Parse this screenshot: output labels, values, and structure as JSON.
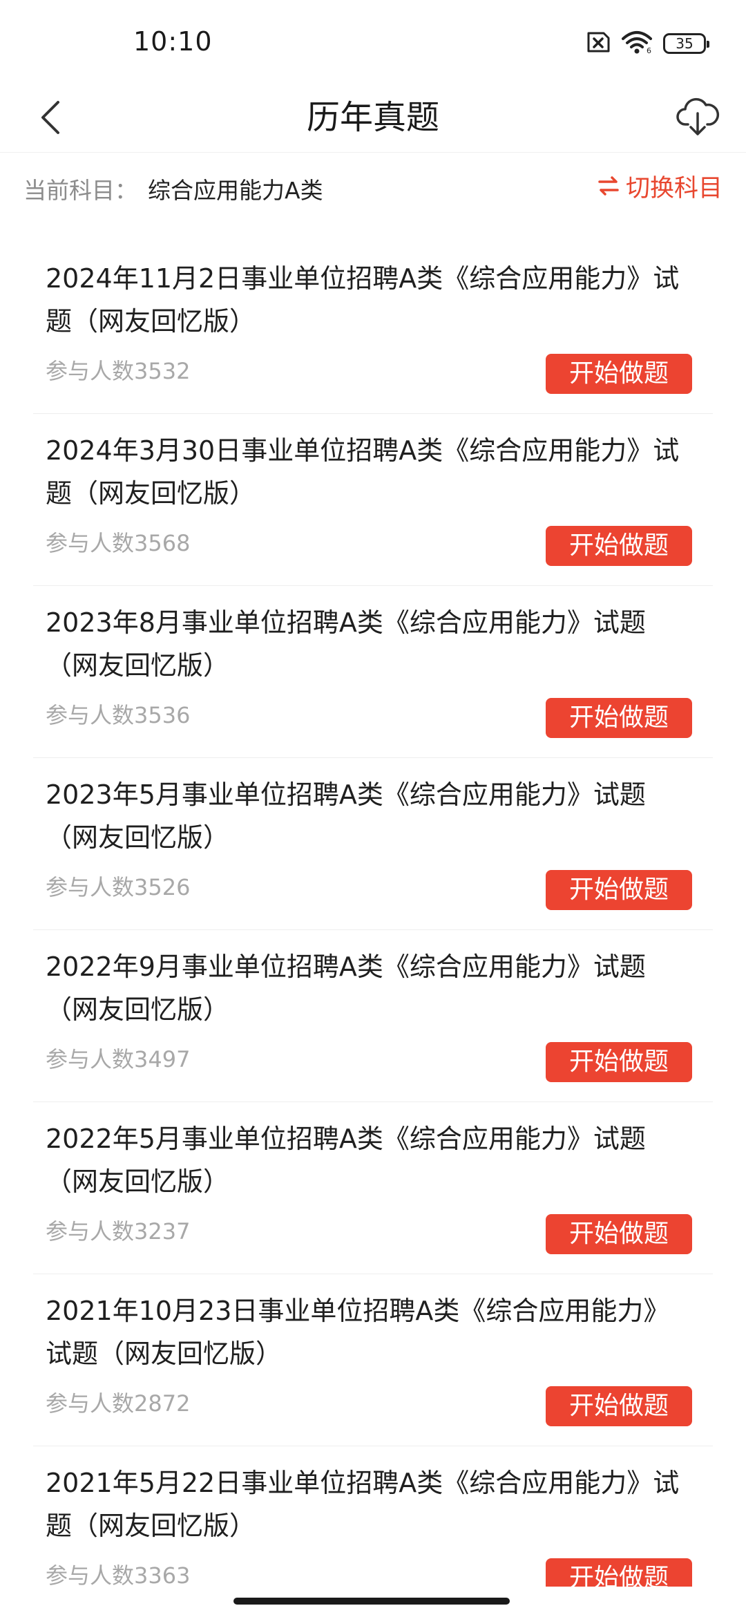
{
  "status_bar": {
    "time": "10:10",
    "battery": "35"
  },
  "nav": {
    "title": "历年真题"
  },
  "subject": {
    "label": "当前科目：",
    "value": "综合应用能力A类",
    "switch_label": "切换科目"
  },
  "colors": {
    "accent": "#ec4431",
    "switch_text": "#e8472f",
    "muted_text": "#a8a8a8"
  },
  "exams": [
    {
      "title": "2024年11月2日事业单位招聘A类《综合应用能力》试题（网友回忆版）",
      "count": "参与人数3532",
      "button": "开始做题"
    },
    {
      "title": "2024年3月30日事业单位招聘A类《综合应用能力》试题（网友回忆版）",
      "count": "参与人数3568",
      "button": "开始做题"
    },
    {
      "title": "2023年8月事业单位招聘A类《综合应用能力》试题（网友回忆版）",
      "count": "参与人数3536",
      "button": "开始做题"
    },
    {
      "title": "2023年5月事业单位招聘A类《综合应用能力》试题（网友回忆版）",
      "count": "参与人数3526",
      "button": "开始做题"
    },
    {
      "title": "2022年9月事业单位招聘A类《综合应用能力》试题（网友回忆版）",
      "count": "参与人数3497",
      "button": "开始做题"
    },
    {
      "title": "2022年5月事业单位招聘A类《综合应用能力》试题（网友回忆版）",
      "count": "参与人数3237",
      "button": "开始做题"
    },
    {
      "title": "2021年10月23日事业单位招聘A类《综合应用能力》试题（网友回忆版）",
      "count": "参与人数2872",
      "button": "开始做题"
    },
    {
      "title": "2021年5月22日事业单位招聘A类《综合应用能力》试题（网友回忆版）",
      "count": "参与人数3363",
      "button": "开始做题"
    }
  ]
}
